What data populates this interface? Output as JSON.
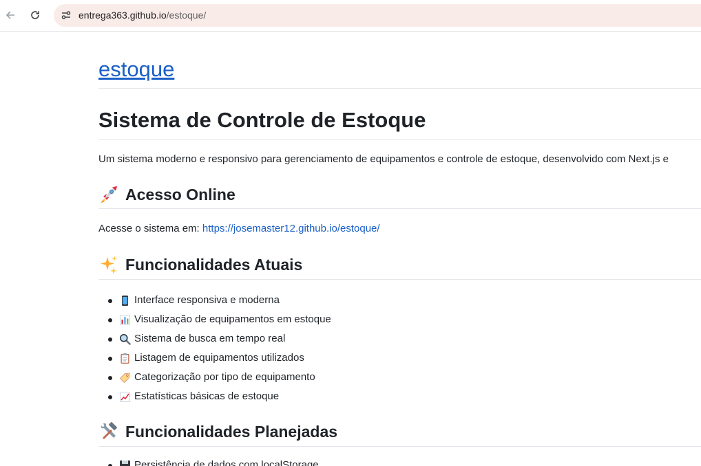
{
  "browser": {
    "url_host": "entrega363.github.io",
    "url_path": "/estoque/",
    "back_icon": "arrow-back-icon",
    "reload_icon": "reload-icon",
    "site_info_icon": "site-info-icon"
  },
  "page": {
    "site_title": "estoque",
    "heading": "Sistema de Controle de Estoque",
    "intro": "Um sistema moderno e responsivo para gerenciamento de equipamentos e controle de estoque, desenvolvido com Next.js e",
    "access_section": {
      "icon": "rocket-icon",
      "title": "Acesso Online",
      "text": "Acesse o sistema em: ",
      "link": "https://josemaster12.github.io/estoque/"
    },
    "current_features": {
      "icon": "sparkles-icon",
      "title": "Funcionalidades Atuais",
      "items": [
        {
          "icon": "mobile-phone-icon",
          "text": "Interface responsiva e moderna"
        },
        {
          "icon": "bar-chart-icon",
          "text": "Visualização de equipamentos em estoque"
        },
        {
          "icon": "magnifier-icon",
          "text": "Sistema de busca em tempo real"
        },
        {
          "icon": "clipboard-icon",
          "text": "Listagem de equipamentos utilizados"
        },
        {
          "icon": "label-tag-icon",
          "text": "Categorização por tipo de equipamento"
        },
        {
          "icon": "chart-increasing-icon",
          "text": "Estatísticas básicas de estoque"
        }
      ]
    },
    "planned_features": {
      "icon": "hammer-wrench-icon",
      "title": "Funcionalidades Planejadas",
      "items": [
        {
          "icon": "floppy-disk-icon",
          "text": "Persistência de dados com localStorage"
        }
      ]
    }
  },
  "colors": {
    "link": "#1a5fc7",
    "omnibox": "#f9ebe8",
    "text": "#1f2328"
  }
}
